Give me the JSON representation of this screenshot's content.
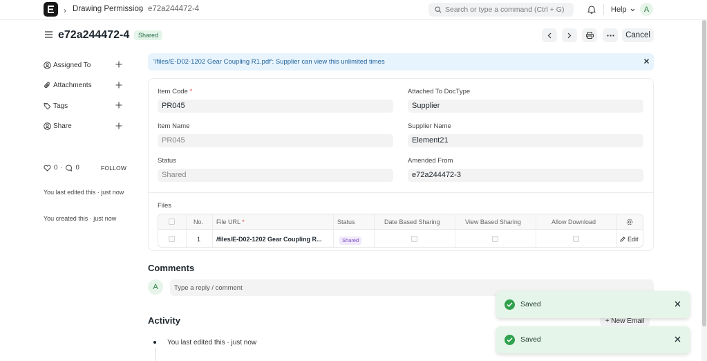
{
  "navbar": {
    "crumbs": [
      "Drawing Permission",
      "e72a244472-4"
    ],
    "search_placeholder": "Search or type a command (Ctrl + G)",
    "help_label": "Help",
    "avatar_letter": "A"
  },
  "header": {
    "title": "e72a244472-4",
    "status_badge": "Shared",
    "cancel_label": "Cancel"
  },
  "sidebar": {
    "items": [
      {
        "label": "Assigned To",
        "icon": "user-icon"
      },
      {
        "label": "Attachments",
        "icon": "paperclip-icon"
      },
      {
        "label": "Tags",
        "icon": "tag-icon"
      },
      {
        "label": "Share",
        "icon": "share-user-icon"
      }
    ],
    "likes": "0",
    "comments": "0",
    "follow_label": "FOLLOW",
    "last_edited": "You last edited this · just now",
    "created": "You created this · just now"
  },
  "alert": {
    "text": "'/files/E-D02-1202 Gear Coupling R1.pdf': Supplier can view this unlimited times"
  },
  "form": {
    "item_code_label": "Item Code",
    "item_code_value": "PR045",
    "item_name_label": "Item Name",
    "item_name_value": "PR045",
    "status_label": "Status",
    "status_value": "Shared",
    "attached_doctype_label": "Attached To DocType",
    "attached_doctype_value": "Supplier",
    "supplier_name_label": "Supplier Name",
    "supplier_name_value": "Element21",
    "amended_from_label": "Amended From",
    "amended_from_value": "e72a244472-3",
    "required_mark": "*"
  },
  "files_table": {
    "section_label": "Files",
    "columns": [
      "No.",
      "File URL",
      "Status",
      "Date Based Sharing",
      "View Based Sharing",
      "Allow Download"
    ],
    "rows": [
      {
        "no": "1",
        "file_url": "/files/E-D02-1202 Gear Coupling R...",
        "status": "Shared",
        "edit_label": "Edit"
      }
    ]
  },
  "comments": {
    "heading": "Comments",
    "avatar_letter": "A",
    "placeholder": "Type a reply / comment"
  },
  "activity": {
    "heading": "Activity",
    "new_email_label": "+ New Email",
    "entries": [
      "You last edited this · just now"
    ]
  },
  "toasts": [
    {
      "message": "Saved"
    },
    {
      "message": "Saved"
    }
  ],
  "colors": {
    "accent_success": "#30a14e",
    "alert_bg": "#e8f4fd",
    "alert_text": "#1d5f9a"
  }
}
